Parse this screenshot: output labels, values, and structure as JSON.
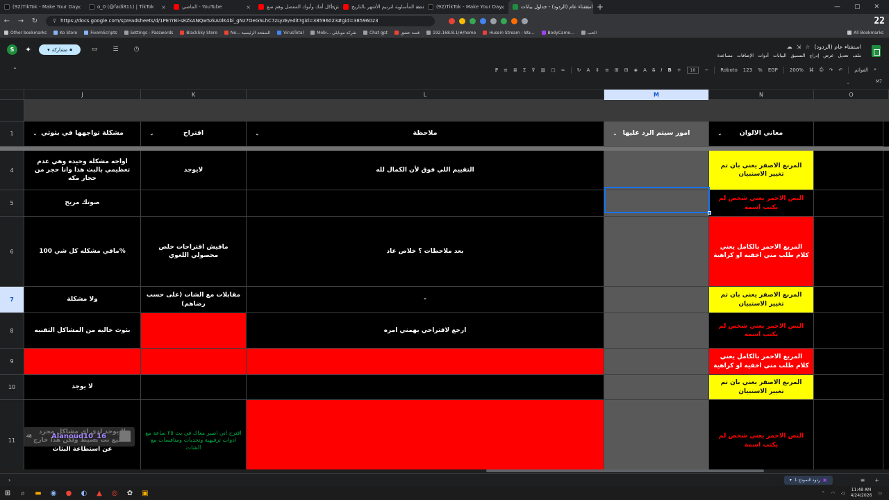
{
  "browser": {
    "tabs": [
      {
        "title": "(92)TikTok - Make Your Day",
        "color": "#000000"
      },
      {
        "title": "ο_0 (@fadi811) | TikTok",
        "color": "#000000"
      },
      {
        "title": "الماضي - YouTube",
        "color": "#ff0000"
      },
      {
        "title": "وش أكل أمك وأبوك المفضل وهم صغ...",
        "color": "#ff0000"
      },
      {
        "title": "القصة المأساوية لترنيم الأشهر بالتاريخ",
        "color": "#ff0000"
      },
      {
        "title": "(92)TikTok - Make Your Day",
        "color": "#000000"
      },
      {
        "title": "استفتاء عام (الردود) - جداول بيانات",
        "color": "#1e8e3e",
        "active": true
      }
    ],
    "new_tab": "+",
    "url": "https://docs.google.com/spreadsheets/d/1PE7rBi-s8ZkANQw5zkA0lK4bl_gNz7OeGSLhC7zLyzE/edit?gid=38596023#gid=38596023",
    "counter": "22",
    "bookmarks": [
      "Other bookmarks",
      "Ko Store",
      "FivemScripts",
      "Settings - Passwords",
      "BlackSky Store",
      "Ne... الصفحة الرئيسية",
      "VirusTotal",
      "Mobi... شركة موبايلي",
      "Chat gpt",
      "قصة عشق",
      "192.168.8.1/#/home",
      "Husein Stream - Wa...",
      "BodyCame...",
      "الحب"
    ],
    "all_bookmarks": "All Bookmarks"
  },
  "sheets": {
    "avatar_letter": "S",
    "share_label": "مشاركة",
    "doc_title": "استفتاء عام (الردود)",
    "menus": [
      "ملف",
      "تعديل",
      "عرض",
      "إدراج",
      "التنسيق",
      "البيانات",
      "أدوات",
      "الإضافات",
      "مساعدة"
    ],
    "toolbar": {
      "search": "القوائم",
      "zoom": "200%",
      "currency": "EGP",
      "decimals": "123",
      "font": "Roboto",
      "font_size": "10"
    },
    "name_box": "M7",
    "column_headers": [
      "J",
      "K",
      "L",
      "M",
      "N",
      "O"
    ],
    "header_row": {
      "row": "1",
      "j": "مشكلة تواجهها في بثوثي",
      "k": "اقتراح",
      "l": "ملاحظة",
      "m": "امور سيتم الرد عليها",
      "n": "معاني الالوان"
    },
    "rows": [
      {
        "num": "4",
        "j": "اواجه مشكلة وحيده وهي عدم تعظيمي بالبث هذا وانا حجر من حجار مكه",
        "k": "لايوجد",
        "l": "التقييم اللي فوق لأن الكمال لله",
        "n": "المربع الاصفر يعني بان تم تغيير الاستبيان"
      },
      {
        "num": "5",
        "j": "صوتك مريح",
        "k": "",
        "l": "",
        "n": "النص الاحمر يعني شخص لم يكتب اسمة"
      },
      {
        "num": "6",
        "j": "%مافي مشكله كل شي 100",
        "k": "مافيش اقتراحات خلص محصولي اللغوي",
        "l": "بعد ملاحظات ؟ خلاص عاد",
        "n": "المربع الاحمر بالكامل يعني كلام طلب مني اخفيه او كراهية"
      },
      {
        "num": "7",
        "j": "ولا مشكلة",
        "k": "مقابلات مع الشات (على حسب رضاهم)",
        "l": "-",
        "n": "المربع الاصفر يعني بان تم تغيير الاستبيان"
      },
      {
        "num": "8",
        "j": "بثوث خاليه من المشاكل التقنيه",
        "k": "",
        "l": "ارجع لاقتراحي يهمني امره",
        "n": "النص الاحمر يعني شخص لم يكتب اسمة"
      },
      {
        "num": "9",
        "j": "",
        "k": "",
        "l": "",
        "n": "المربع الاحمر بالكامل يعني كلام طلب مني اخفيه او كراهية"
      },
      {
        "num": "10",
        "j": "لا يوجد",
        "k": "",
        "l": "",
        "n": "المربع الاصفر يعني بان تم تغيير الاستبيان"
      },
      {
        "num": "11",
        "j": "لا يوجد لدي اي مشاكل مجرد تقطيع نت بسيط ولكن هذا خارج عن استطاعة البثاث",
        "k": "اقترح اني اصير معاك في بث ٢٥ ساعة مع ادوات ترفيهية وتحديات ومنافسات مع الشات",
        "l": "",
        "n": "النص الاحمر يعني شخص لم يكتب اسمة"
      }
    ],
    "sheet_tab": "ردود النموذج 1",
    "colors": {
      "red": "#ff0000",
      "yellow": "#ffff00",
      "gray_column": "#595959",
      "selection": "#1a73e8"
    }
  },
  "overlay": {
    "handle": "Alanoud10_16",
    "count": "48"
  },
  "taskbar": {
    "time": "11:48 AM",
    "date": "4/24/2026"
  }
}
